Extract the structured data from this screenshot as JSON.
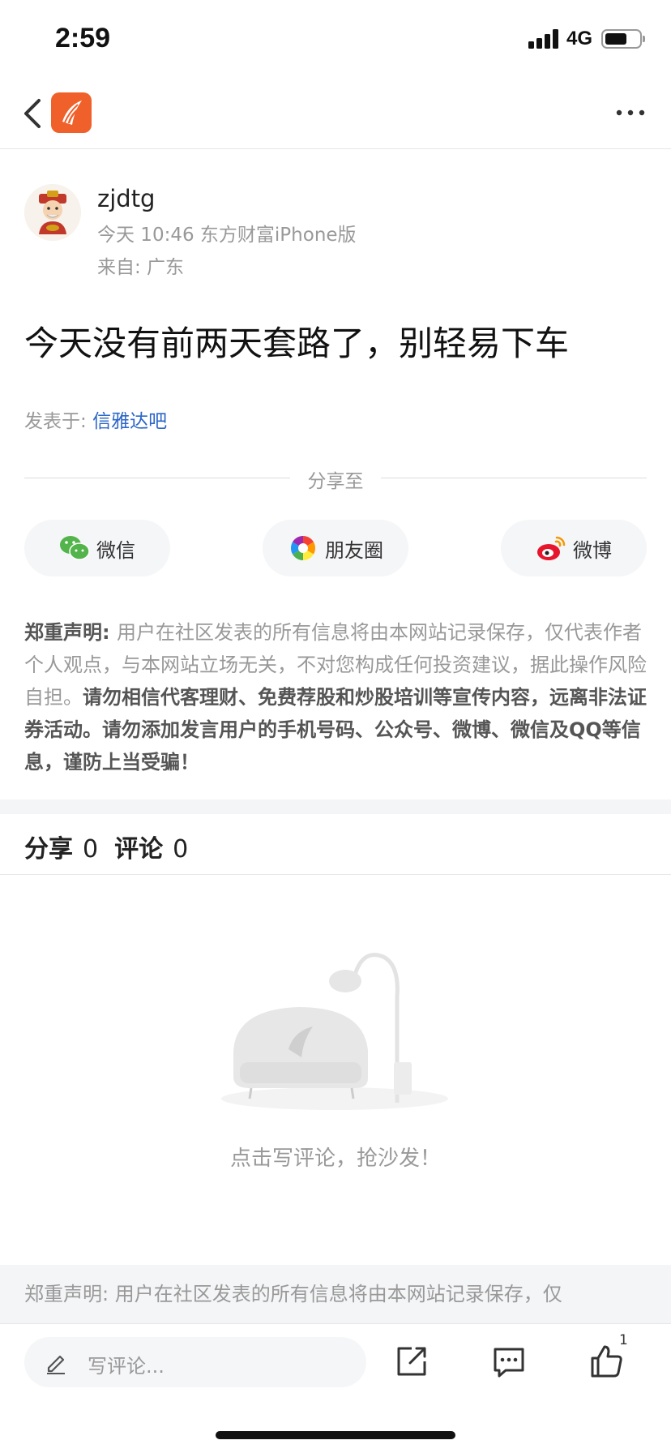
{
  "status_bar": {
    "time": "2:59",
    "network": "4G"
  },
  "nav": {
    "back_icon": "chevron-left-icon",
    "logo_icon": "eastmoney-logo-icon",
    "more_icon": "more-dots-icon"
  },
  "post": {
    "author": "zjdtg",
    "meta": "今天 10:46 东方财富iPhone版",
    "location": "来自: 广东",
    "title": "今天没有前两天套路了，别轻易下车",
    "posted_in_label": "发表于: ",
    "posted_in_link": "信雅达吧"
  },
  "share": {
    "label": "分享至",
    "buttons": [
      {
        "label": "微信",
        "icon": "wechat-icon"
      },
      {
        "label": "朋友圈",
        "icon": "moments-icon"
      },
      {
        "label": "微博",
        "icon": "weibo-icon"
      }
    ]
  },
  "disclaimer": {
    "prefix": "郑重声明: ",
    "normal": "用户在社区发表的所有信息将由本网站记录保存，仅代表作者个人观点，与本网站立场无关，不对您构成任何投资建议，据此操作风险自担。",
    "bold": "请勿相信代客理财、免费荐股和炒股培训等宣传内容，远离非法证券活动。请勿添加发言用户的手机号码、公众号、微博、微信及QQ等信息，谨防上当受骗！"
  },
  "stats": {
    "share_label": "分享",
    "share_count": "0",
    "comment_label": "评论",
    "comment_count": "0"
  },
  "empty_state": {
    "text": "点击写评论，抢沙发！"
  },
  "bottom_disclaimer": "郑重声明: 用户在社区发表的所有信息将由本网站记录保存，仅",
  "toolbar": {
    "comment_placeholder": "写评论...",
    "like_count": "1"
  },
  "colors": {
    "brand": "#f0602a",
    "link": "#2b66c8"
  }
}
